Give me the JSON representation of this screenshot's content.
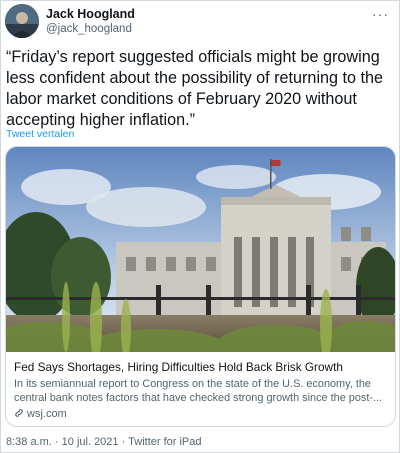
{
  "author": {
    "name": "Jack Hoogland",
    "handle": "@jack_hoogland",
    "avatar_icon": "avatar-photo"
  },
  "tweet": {
    "text": "“Friday’s report suggested officials might be growing less confident about the possibility of returning to the labor market conditions of February 2020 without accepting higher inflation.”",
    "translate_link": "Tweet vertalen"
  },
  "card": {
    "image_icon": "federal-reserve-building-photo",
    "title": "Fed Says Shortages, Hiring Difficulties Hold Back Brisk Growth",
    "description": "In its semiannual report to Congress on the state of the U.S. economy, the central bank notes factors that have checked strong growth since the post-...",
    "domain": "wsj.com"
  },
  "meta": {
    "time": "8:38 a.m.",
    "separator": "·",
    "date": "10 jul. 2021",
    "source": "Twitter for iPad"
  },
  "colors": {
    "link": "#1d9bf0",
    "secondary_text": "#536471",
    "border": "#cfd9de"
  }
}
